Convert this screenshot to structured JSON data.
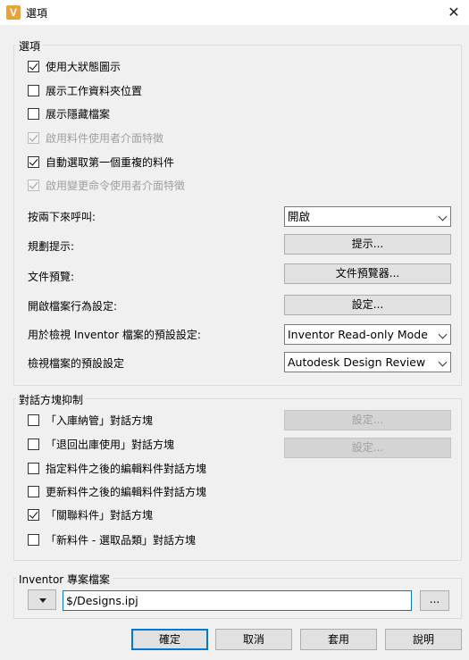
{
  "window": {
    "title": "選項",
    "app_icon_letter": "V",
    "close_glyph": "✕"
  },
  "options": {
    "label": "選項",
    "checks": [
      {
        "label": "使用大狀態圖示",
        "checked": true,
        "disabled": false
      },
      {
        "label": "展示工作資料夾位置",
        "checked": false,
        "disabled": false
      },
      {
        "label": "展示隱藏檔案",
        "checked": false,
        "disabled": false
      },
      {
        "label": "啟用料件使用者介面特徵",
        "checked": true,
        "disabled": true
      },
      {
        "label": "自動選取第一個重複的料件",
        "checked": true,
        "disabled": false
      },
      {
        "label": "啟用變更命令使用者介面特徵",
        "checked": true,
        "disabled": true
      }
    ],
    "double_click": {
      "label": "按兩下來呼叫:",
      "value": "開啟"
    },
    "planning_tips": {
      "label": "規劃提示:",
      "button": "提示..."
    },
    "file_preview": {
      "label": "文件預覽:",
      "button": "文件預覽器..."
    },
    "open_behavior": {
      "label": "開啟檔案行為設定:",
      "button": "設定..."
    },
    "inventor_default": {
      "label": "用於檢視 Inventor 檔案的預設設定:",
      "value": "Inventor Read-only Mode"
    },
    "view_default": {
      "label": "檢視檔案的預設設定",
      "value": "Autodesk Design Review"
    }
  },
  "dialog_suppress": {
    "label": "對話方塊抑制",
    "checks": [
      {
        "label": "「入庫納管」對話方塊",
        "checked": false
      },
      {
        "label": "「退回出庫使用」對話方塊",
        "checked": false
      },
      {
        "label": "指定料件之後的編輯料件對話方塊",
        "checked": false
      },
      {
        "label": "更新料件之後的編輯料件對話方塊",
        "checked": false
      },
      {
        "label": "「關聯料件」對話方塊",
        "checked": true
      },
      {
        "label": "「新料件 - 選取品類」對話方塊",
        "checked": false
      }
    ],
    "settings_button_1": "設定...",
    "settings_button_2": "設定..."
  },
  "project": {
    "label": "Inventor 專案檔案",
    "path": "$/Designs.ipj",
    "browse_label": "..."
  },
  "footer": {
    "ok": "確定",
    "cancel": "取消",
    "apply": "套用",
    "help": "說明"
  }
}
